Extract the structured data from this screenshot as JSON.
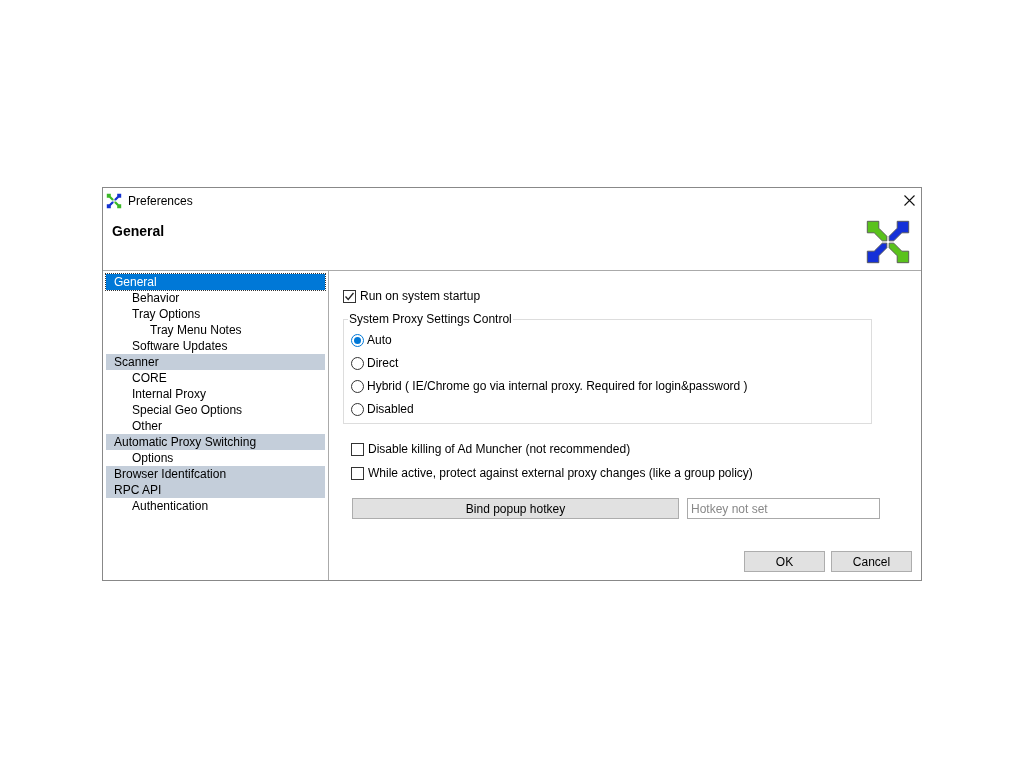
{
  "window": {
    "title": "Preferences"
  },
  "header": {
    "title": "General"
  },
  "tree": [
    {
      "label": "General",
      "selected": true,
      "children": [
        {
          "label": "Behavior",
          "selected": false
        },
        {
          "label": "Tray Options",
          "selected": false,
          "children": [
            {
              "label": "Tray Menu Notes",
              "selected": false
            }
          ]
        },
        {
          "label": "Software Updates",
          "selected": false
        }
      ]
    },
    {
      "label": "Scanner",
      "selected": false,
      "children": [
        {
          "label": "CORE",
          "selected": false
        },
        {
          "label": "Internal Proxy",
          "selected": false
        },
        {
          "label": "Special Geo Options",
          "selected": false
        },
        {
          "label": "Other",
          "selected": false
        }
      ]
    },
    {
      "label": "Automatic Proxy Switching",
      "selected": false,
      "children": [
        {
          "label": "Options",
          "selected": false
        }
      ]
    },
    {
      "label": "Browser Identifcation",
      "selected": false
    },
    {
      "label": "RPC API",
      "selected": false,
      "children": [
        {
          "label": "Authentication",
          "selected": false
        }
      ]
    }
  ],
  "startup": {
    "label": "Run on system startup",
    "checked": true
  },
  "proxy_group": {
    "title": "System Proxy Settings Control",
    "options": [
      {
        "label": "Auto",
        "selected": true
      },
      {
        "label": "Direct",
        "selected": false
      },
      {
        "label": "Hybrid ( IE/Chrome go via internal proxy. Required for login&password )",
        "selected": false
      },
      {
        "label": "Disabled",
        "selected": false
      }
    ]
  },
  "checkboxes": [
    {
      "label": "Disable killing of Ad Muncher (not recommended)",
      "checked": false
    },
    {
      "label": "While active, protect against external proxy changes (like a group policy)",
      "checked": false
    }
  ],
  "hotkey": {
    "button": "Bind popup hotkey",
    "placeholder": "Hotkey not set"
  },
  "buttons": [
    "OK",
    "Cancel"
  ]
}
